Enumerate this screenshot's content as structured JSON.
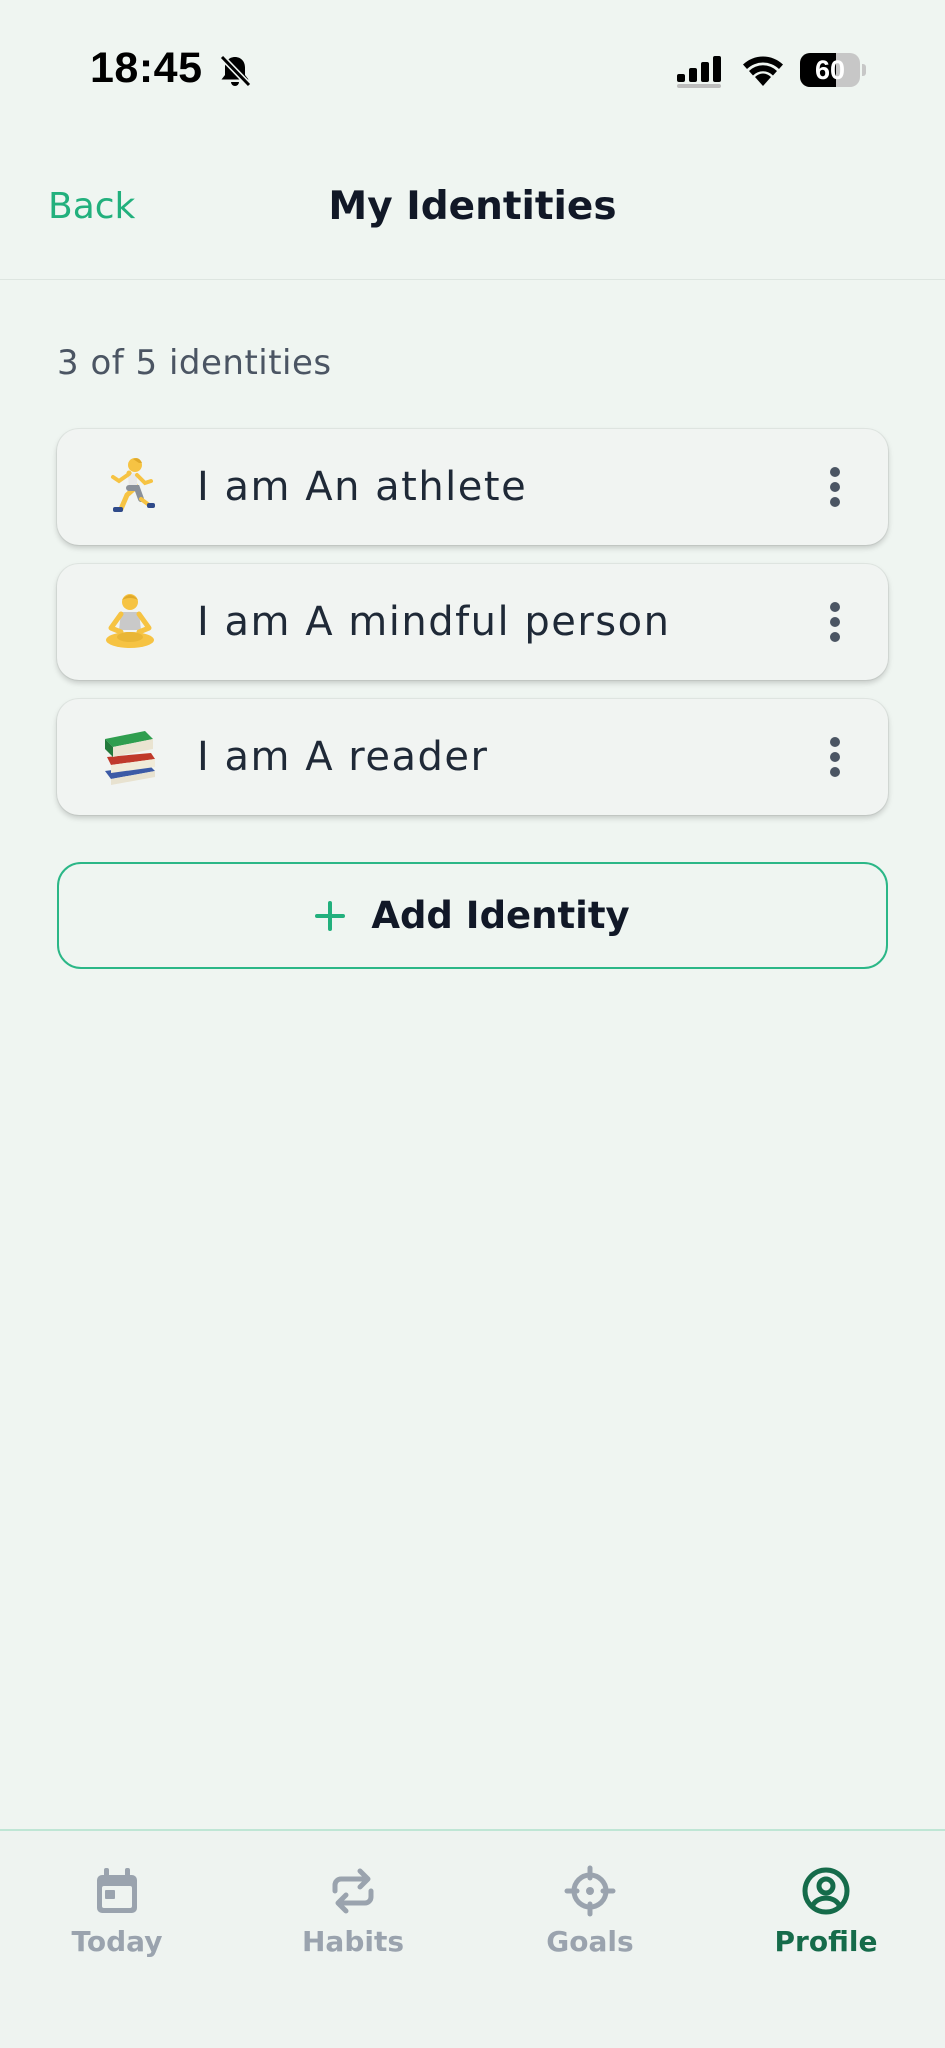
{
  "status_bar": {
    "time": "18:45",
    "battery": "60",
    "battery_level": 0.6
  },
  "header": {
    "back_label": "Back",
    "title": "My Identities"
  },
  "identity_count": "3 of 5 identities",
  "identities": [
    {
      "icon": "running-person-icon",
      "label": "I am An athlete"
    },
    {
      "icon": "meditating-person-icon",
      "label": "I am A mindful person"
    },
    {
      "icon": "books-icon",
      "label": "I am A reader"
    }
  ],
  "add_button": {
    "label": "Add Identity"
  },
  "tabs": [
    {
      "icon": "calendar-icon",
      "label": "Today",
      "active": false
    },
    {
      "icon": "repeat-icon",
      "label": "Habits",
      "active": false
    },
    {
      "icon": "target-icon",
      "label": "Goals",
      "active": false
    },
    {
      "icon": "profile-icon",
      "label": "Profile",
      "active": true
    }
  ],
  "colors": {
    "accent": "#22b07d",
    "active_tab": "#156b4a",
    "inactive_tab": "#9aa3ae",
    "background": "#eff5f1"
  }
}
